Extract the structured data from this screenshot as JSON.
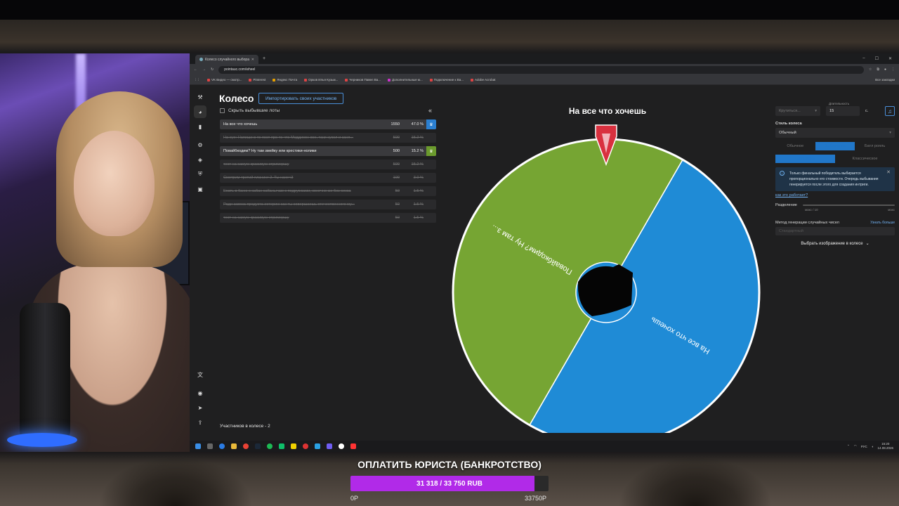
{
  "browser": {
    "tab_title": "Колесо случайного выбора",
    "url": "pointauc.com/wheel",
    "bookmarks": [
      "VK Видео — смотр...",
      "Pinterest",
      "Яндекс Почта",
      "Орков Илья Кузьм...",
      "Черников Павел Ва...",
      "Дополнительные м...",
      "Подключение к Ва...",
      "Adobe Acrobat"
    ],
    "all_bookmarks": "Все закладки"
  },
  "app": {
    "title": "Колесо",
    "import_label": "Импортировать своих участников",
    "hide_label": "Скрыть выбывшие лоты",
    "collapse_glyph": "«",
    "participants_count": "Участников в колесе - 2",
    "lots": [
      {
        "name": "На все что хочешь",
        "amount": "1550",
        "percent": "47.0 %",
        "state": "active",
        "color": "blue"
      },
      {
        "name": "На еуе: Напиши в то пост про то что Мэддисон все, таки кукол и заня...",
        "amount": "500",
        "percent": "15.2 %",
        "state": "struck"
      },
      {
        "name": "Повайбкодим? Ну там змейку или крестики-нолики",
        "amount": "500",
        "percent": "15.2 %",
        "state": "active",
        "color": "green"
      },
      {
        "name": "тест на самую красивую стримершу",
        "amount": "500",
        "percent": "15.2 %",
        "state": "struck"
      },
      {
        "name": "Смотрим третий плэнинг 2. Ты нахе<3",
        "amount": "100",
        "percent": "3.0 %",
        "state": "struck"
      },
      {
        "name": "Ехать в баню с кабан кабанычам с подружками, конечно же без секса",
        "amount": "50",
        "percent": "1.5 %",
        "state": "struck"
      },
      {
        "name": "Ради завоза продукта истерию как ты совершаешь отечественного му...",
        "amount": "50",
        "percent": "1.5 %",
        "state": "struck"
      },
      {
        "name": "тест на самую красивую стримершу",
        "amount": "50",
        "percent": "1.5 %",
        "state": "struck"
      }
    ]
  },
  "wheel": {
    "title": "На все что хочешь",
    "segments": [
      {
        "label": "На все что хочешь",
        "share": 0.5,
        "color": "#1f8bd6"
      },
      {
        "label": "Повайбкодим? Ну там з...",
        "share": 0.5,
        "color": "#76a533"
      }
    ],
    "rotation_deg": 30
  },
  "settings": {
    "spin_select": "Крутиться...",
    "duration_label": "Длительность",
    "duration_value": "15",
    "duration_unit": "с.",
    "style_label": "Стиль колеса",
    "style_value": "Обычный",
    "mode_tabs": [
      "Обычное",
      "Выбывание",
      "Батл рояль"
    ],
    "mode_tabs_2": [
      "Случайное",
      "Классическое"
    ],
    "info_text": "Только финальный победитель выбирается пропорционально его стоимости. Очередь выбывания генерируется после этого для создания интриги.",
    "how_link": "как это работает?",
    "split_label": "Разделение",
    "split_min": "макс / 10",
    "split_max": "макс",
    "rng_label": "Метод генерации случайных чисел",
    "rng_more": "Узнать больше",
    "rng_value": "Стандартный",
    "image_label": "Выбрать изображение в колесе",
    "accent": "#2177c9"
  },
  "taskbar": {
    "lang": "РУС",
    "time": "15:20",
    "date": "14.08.2026"
  },
  "goal": {
    "title": "ОПЛАТИТЬ ЮРИСТА (БАНКРОТСТВО)",
    "progress_text": "31 318 / 33 750 RUB",
    "current": 31318,
    "target": 33750,
    "min_label": "0Р",
    "max_label": "33750Р",
    "fill_color": "#b12ae8"
  }
}
